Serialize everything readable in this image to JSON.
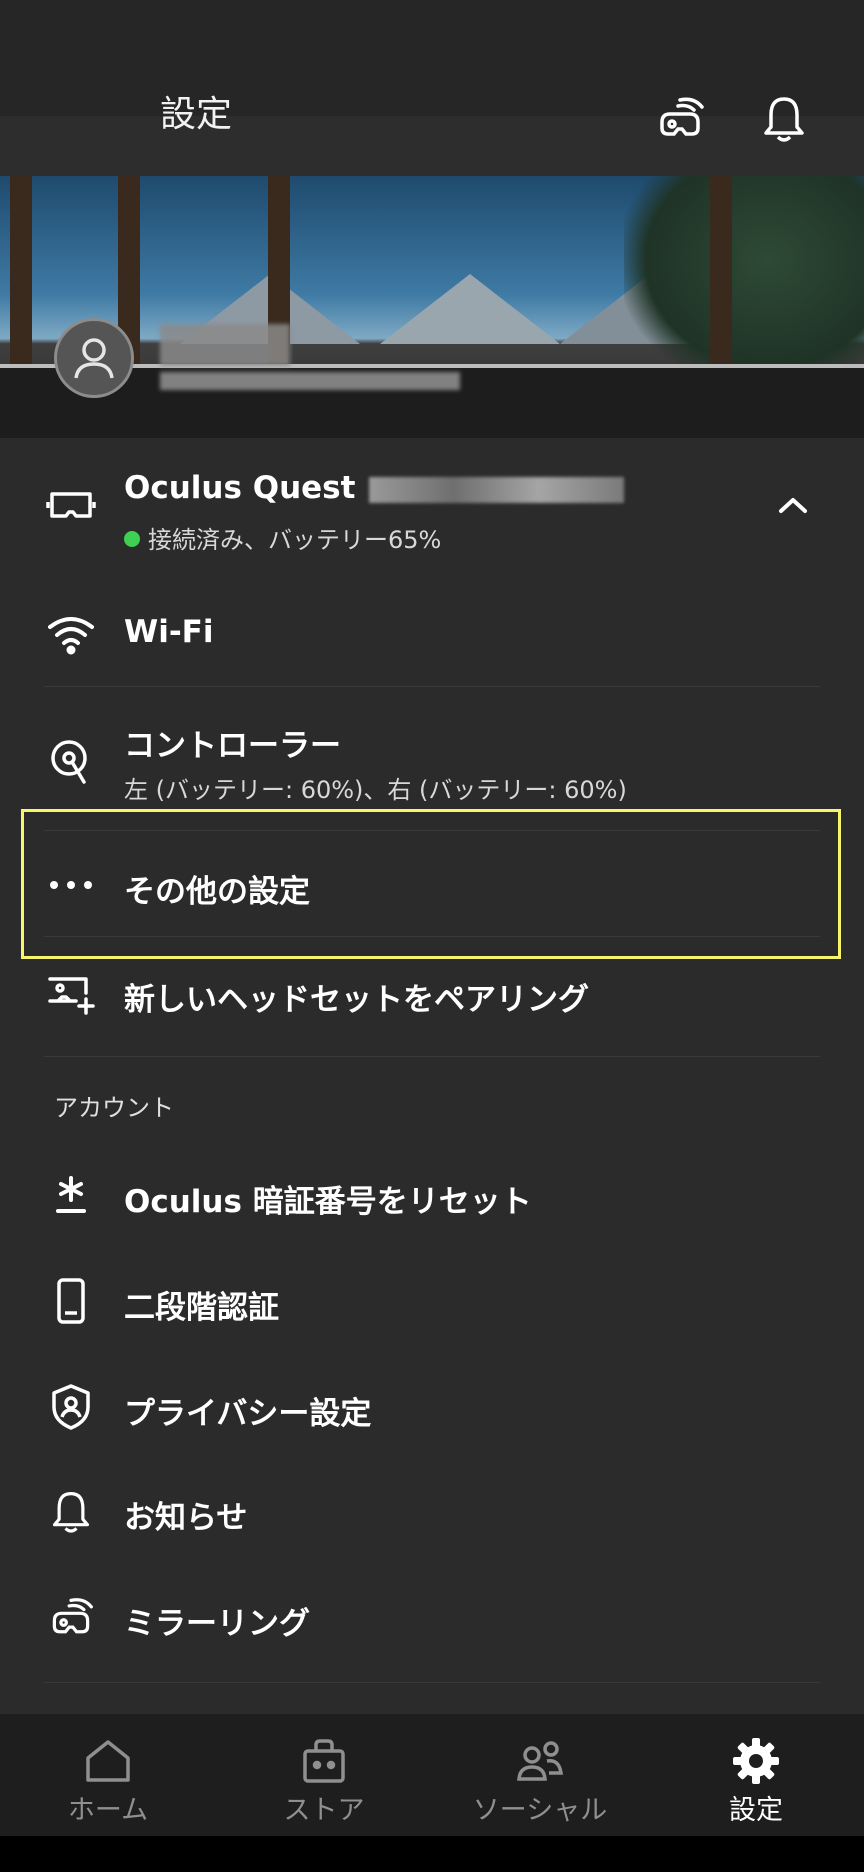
{
  "header": {
    "title": "設定",
    "mirror_icon": "headset-cast-icon",
    "bell_icon": "bell-icon"
  },
  "profile": {
    "avatar_icon": "user-icon"
  },
  "device": {
    "name": "Oculus Quest",
    "status": "接続済み、バッテリー65%",
    "status_color": "#3ecf55",
    "icon": "headset-icon",
    "toggle_icon": "chevron-up-icon"
  },
  "items": {
    "wifi": "Wi-Fi",
    "controller": "コントローラー",
    "controller_status": "左 (バッテリー: 60%)、右 (バッテリー: 60%)",
    "more": "その他の設定",
    "pair": "新しいヘッドセットをペアリング"
  },
  "account": {
    "section_title": "アカウント",
    "pin": "Oculus 暗証番号をリセット",
    "twofactor": "二段階認証",
    "privacy": "プライバシー設定",
    "notifications": "お知らせ",
    "mirroring": "ミラーリング"
  },
  "nav": {
    "home": "ホーム",
    "store": "ストア",
    "social": "ソーシャル",
    "settings": "設定",
    "active": "settings"
  },
  "colors": {
    "highlight": "#f7f56a",
    "background": "#2b2b2b",
    "nav_background": "#1e1e1e"
  }
}
